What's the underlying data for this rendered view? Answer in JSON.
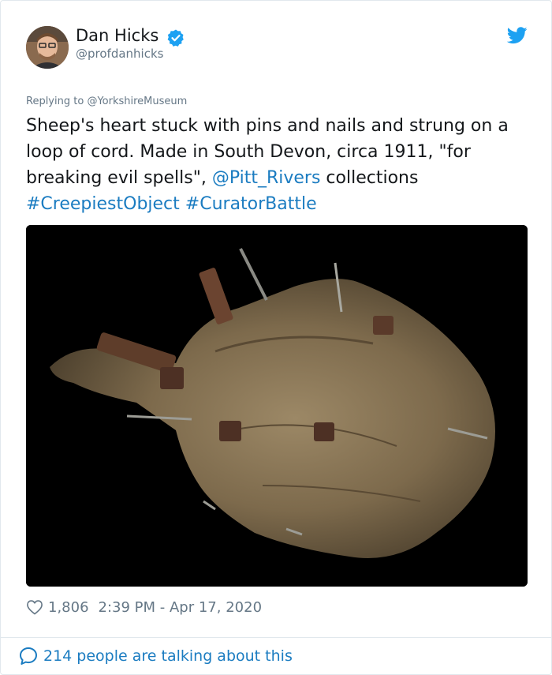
{
  "author": {
    "display_name": "Dan Hicks",
    "handle": "@profdanhicks",
    "verified": true
  },
  "reply": {
    "prefix": "Replying to ",
    "target": "@YorkshireMuseum"
  },
  "tweet": {
    "text_before_mention": "Sheep's heart stuck with pins and nails and strung on a loop of cord. Made in South Devon, circa 1911, \"for breaking evil spells\", ",
    "mention": "@Pitt_Rivers",
    "text_after_mention": " collections",
    "hashtags": [
      "#CreepiestObject",
      "#CuratorBattle"
    ]
  },
  "media": {
    "icon": "photo-icon",
    "background_color": "#000000"
  },
  "meta": {
    "likes": "1,806",
    "timestamp": "2:39 PM - Apr 17, 2020"
  },
  "footer": {
    "talking_label": "214 people are talking about this"
  },
  "colors": {
    "link": "#1b7cc1",
    "secondary_text": "#657786",
    "twitter_blue": "#1da1f2",
    "border": "#e1e8ed"
  }
}
